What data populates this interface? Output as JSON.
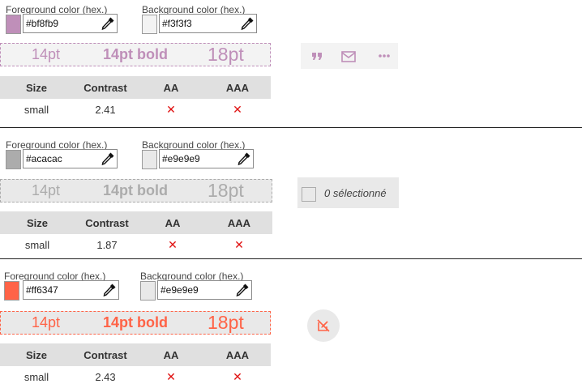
{
  "colors": {
    "fg1": "#bf8fb9",
    "bg1": "#f3f3f3",
    "fg2": "#acacac",
    "bg2": "#e9e9e9",
    "fg3": "#ff6347",
    "bg3": "#e9e9e9",
    "fail": "#e01010"
  },
  "sections": [
    {
      "fg_label": "Foreground color (hex.)",
      "fg_value": "#bf8fb9",
      "bg_label": "Background color (hex.)",
      "bg_value": "#f3f3f3",
      "preview": {
        "small": "14pt",
        "bold": "14pt bold",
        "large": "18pt"
      },
      "table": {
        "headers": [
          "Size",
          "Contrast",
          "AA",
          "AAA"
        ],
        "row": {
          "size": "small",
          "contrast": "2.41",
          "aa": "✕",
          "aaa": "✕"
        }
      }
    },
    {
      "fg_label": "Foreground color (hex.)",
      "fg_value": "#acacac",
      "bg_label": "Background color (hex.)",
      "bg_value": "#e9e9e9",
      "preview": {
        "small": "14pt",
        "bold": "14pt bold",
        "large": "18pt"
      },
      "table": {
        "headers": [
          "Size",
          "Contrast",
          "AA",
          "AAA"
        ],
        "row": {
          "size": "small",
          "contrast": "1.87",
          "aa": "✕",
          "aaa": "✕"
        }
      }
    },
    {
      "fg_label": "Foreground color (hex.)",
      "fg_value": "#ff6347",
      "bg_label": "Background color (hex.)",
      "bg_value": "#e9e9e9",
      "preview": {
        "small": "14pt",
        "bold": "14pt bold",
        "large": "18pt"
      },
      "table": {
        "headers": [
          "Size",
          "Contrast",
          "AA",
          "AAA"
        ],
        "row": {
          "size": "small",
          "contrast": "2.43",
          "aa": "✕",
          "aaa": "✕"
        }
      }
    }
  ],
  "demos": {
    "toolbar_icons": [
      "quote-icon",
      "mail-icon",
      "more-icon"
    ],
    "selection_label": "0 sélectionné",
    "disabled_edit_icon": "edit-off-icon"
  }
}
